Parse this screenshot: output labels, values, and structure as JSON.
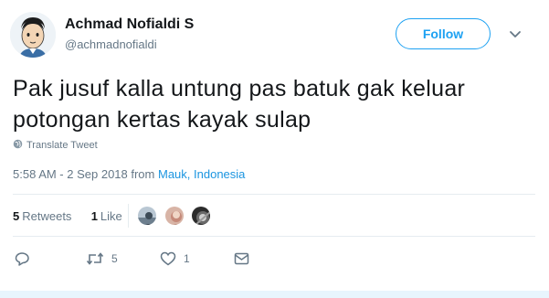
{
  "author": {
    "name": "Achmad Nofialdi S",
    "handle": "@achmadnofialdi",
    "avatar_icon": "cartoon-avatar-icon"
  },
  "header": {
    "follow_label": "Follow",
    "menu_icon": "chevron-down-icon"
  },
  "tweet": {
    "line1": "Pak jusuf kalla untung pas batuk gak keluar",
    "line2": "potongan kertas kayak sulap"
  },
  "translate": {
    "label": "Translate Tweet",
    "icon": "globe-icon"
  },
  "meta": {
    "timestamp": "5:58 AM - 2 Sep 2018 from",
    "location": "Mauk, Indonesia"
  },
  "stats": {
    "retweets_count": "5",
    "retweets_label": "Retweets",
    "likes_count": "1",
    "likes_label": "Like"
  },
  "actions": {
    "reply_icon": "reply-icon",
    "retweet_icon": "retweet-icon",
    "retweet_count": "5",
    "like_icon": "heart-icon",
    "like_count": "1",
    "dm_icon": "envelope-icon"
  },
  "colors": {
    "accent": "#1da1f2",
    "link": "#1b95e0",
    "muted": "#657786",
    "text": "#14171a"
  }
}
